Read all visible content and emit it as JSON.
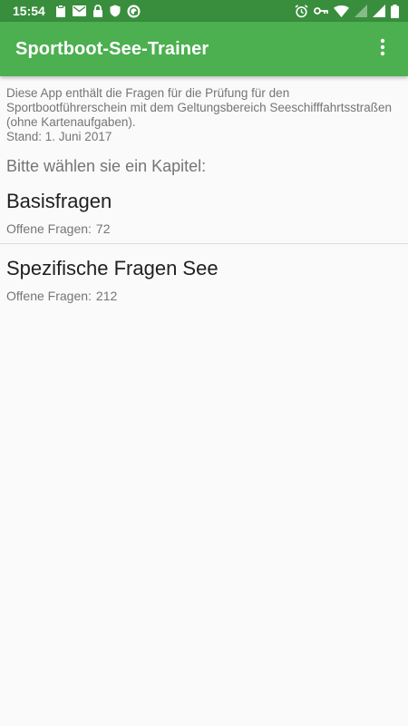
{
  "status_bar": {
    "time": "15:54",
    "left_icons": [
      "clipboard-icon",
      "mail-icon",
      "lock-icon",
      "shield-icon",
      "sync-app-icon"
    ],
    "right_icons": [
      "alarm-icon",
      "vpn-key-icon",
      "wifi-icon",
      "signal-icon",
      "signal-icon",
      "battery-icon"
    ],
    "background": "#388e3c"
  },
  "app_bar": {
    "title": "Sportboot-See-Trainer",
    "menu_icon": "more-vert-icon",
    "background": "#4caf50"
  },
  "intro": {
    "text": "Diese App enthält die Fragen für die Prüfung für den Sportbootführerschein mit dem Geltungsbereich Seeschifffahrtsstraßen (ohne Kartenaufgaben).",
    "date": "Stand: 1. Juni 2017"
  },
  "prompt": "Bitte wählen sie ein Kapitel:",
  "chapters": [
    {
      "title": "Basisfragen",
      "open_label": "Offene Fragen:",
      "open_count": "72"
    },
    {
      "title": "Spezifische Fragen See",
      "open_label": "Offene Fragen:",
      "open_count": "212"
    }
  ]
}
